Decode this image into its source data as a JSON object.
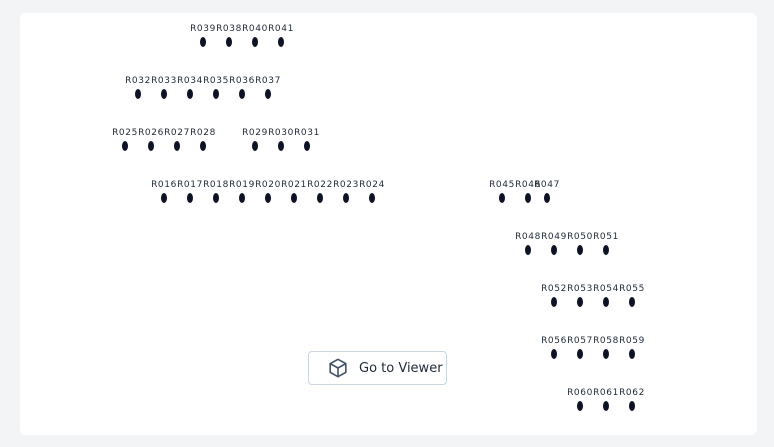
{
  "rows": [
    {
      "labels": [
        "R039",
        "R038",
        "R040",
        "R041"
      ]
    },
    {
      "labels": [
        "R032",
        "R033",
        "R034",
        "R035",
        "R036",
        "R037"
      ]
    },
    {
      "labels": [
        "R025",
        "R026",
        "R027",
        "R028"
      ]
    },
    {
      "labels": [
        "R029",
        "R030",
        "R031"
      ]
    },
    {
      "labels": [
        "R016",
        "R017",
        "R018",
        "R019",
        "R020",
        "R021",
        "R022",
        "R023",
        "R024"
      ]
    },
    {
      "labels": [
        "R045",
        "R046",
        "R047"
      ]
    },
    {
      "labels": [
        "R048",
        "R049",
        "R050",
        "R051"
      ]
    },
    {
      "labels": [
        "R052",
        "R053",
        "R054",
        "R055"
      ]
    },
    {
      "labels": [
        "R056",
        "R057",
        "R058",
        "R059"
      ]
    },
    {
      "labels": [
        "R060",
        "R061",
        "R062"
      ]
    }
  ],
  "viewer_button": {
    "label": "Go to Viewer",
    "icon": "cube-icon"
  },
  "colors": {
    "background": "#f3f4f6",
    "card": "#ffffff",
    "dot": "#0b1324",
    "text": "#1f2937"
  }
}
